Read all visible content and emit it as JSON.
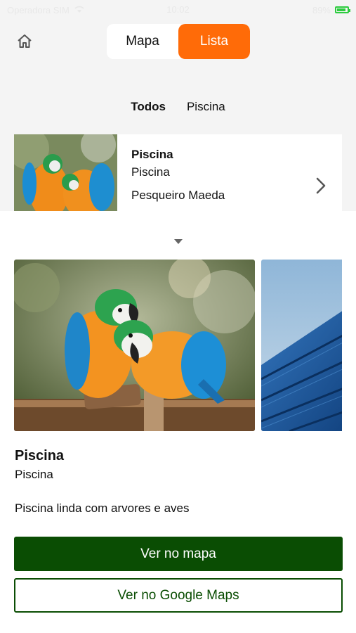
{
  "status_bar": {
    "carrier": "Operadora SIM",
    "time": "10:02",
    "battery_label": "89%",
    "battery_level": 0.89
  },
  "header": {
    "home_icon": "home-icon",
    "tabs": [
      {
        "label": "Mapa",
        "active": false
      },
      {
        "label": "Lista",
        "active": true
      }
    ],
    "accent_color": "#ff6b08"
  },
  "filters": [
    {
      "label": "Todos",
      "active": true
    },
    {
      "label": "Piscina",
      "active": false
    }
  ],
  "list_item": {
    "title": "Piscina",
    "category": "Piscina",
    "place": "Pesqueiro Maeda"
  },
  "detail": {
    "title": "Piscina",
    "category": "Piscina",
    "description": "Piscina linda com arvores e aves",
    "primary_button": "Ver no mapa",
    "secondary_button": "Ver no Google Maps",
    "button_color": "#0a4d03"
  }
}
